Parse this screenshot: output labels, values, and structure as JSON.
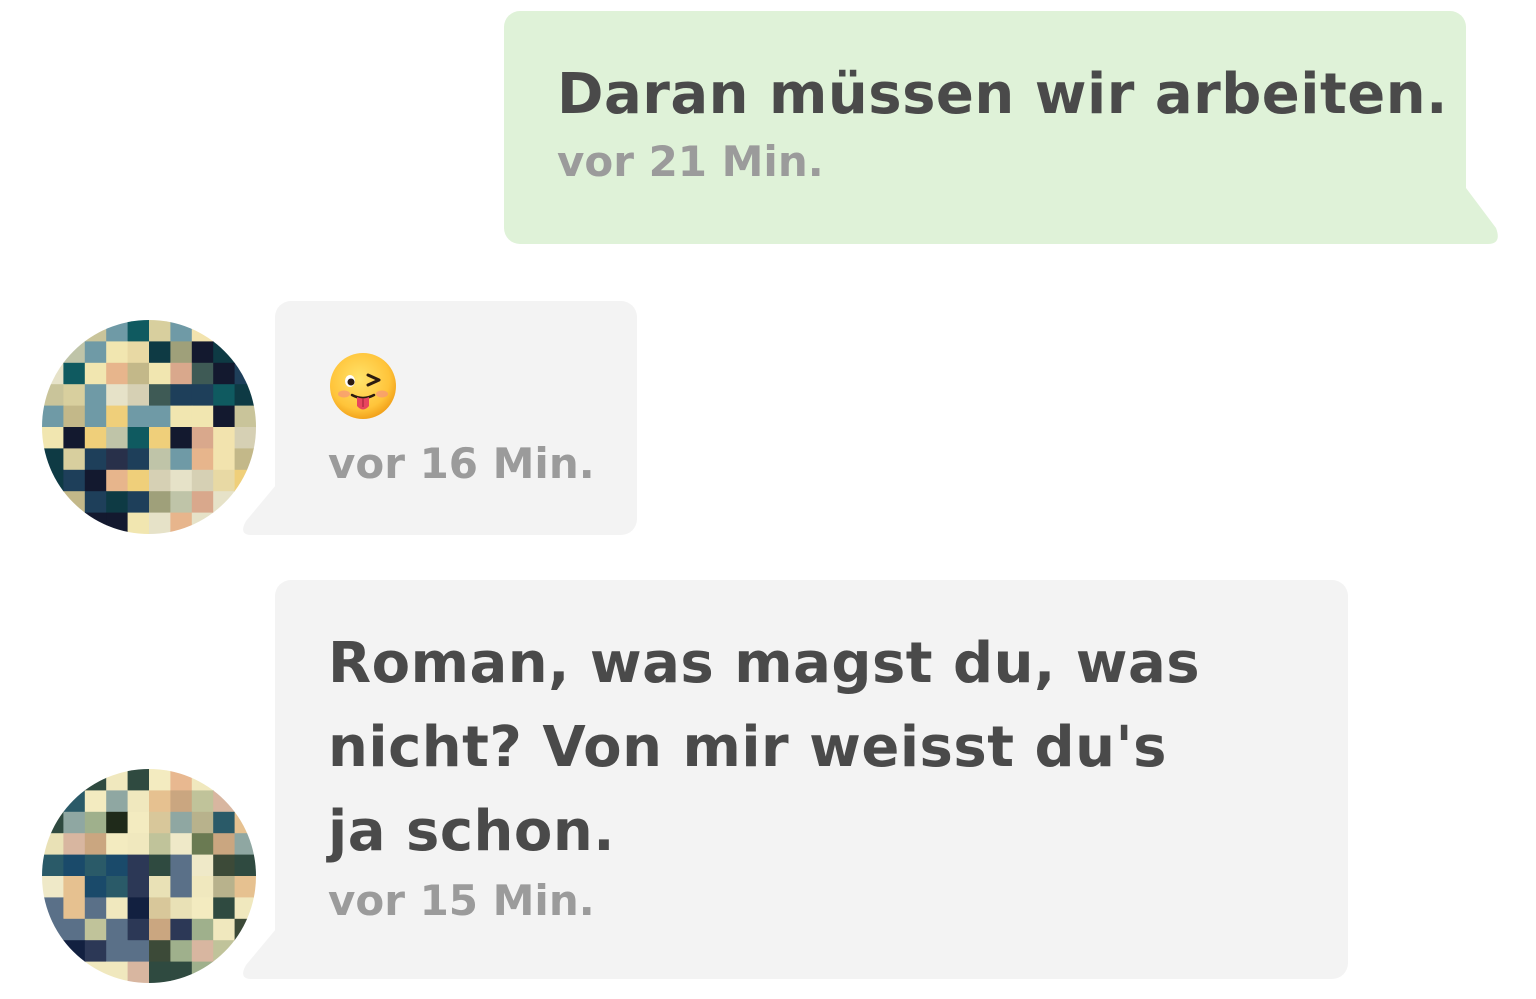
{
  "messages": [
    {
      "direction": "outgoing",
      "text": "Daran müssen wir arbeiten.",
      "time": "vor 21 Min."
    },
    {
      "direction": "incoming",
      "emoji": "winking-face-with-tongue-icon",
      "time": "vor 16 Min."
    },
    {
      "direction": "incoming",
      "text": "Roman, was magst du, was nicht? Von mir weisst du's ja schon.",
      "time": "vor 15 Min."
    }
  ],
  "colors": {
    "outgoing_bubble": "#dff2d8",
    "incoming_bubble": "#f3f3f3",
    "text": "#4a4a4a",
    "timestamp": "#9b9b9b"
  }
}
